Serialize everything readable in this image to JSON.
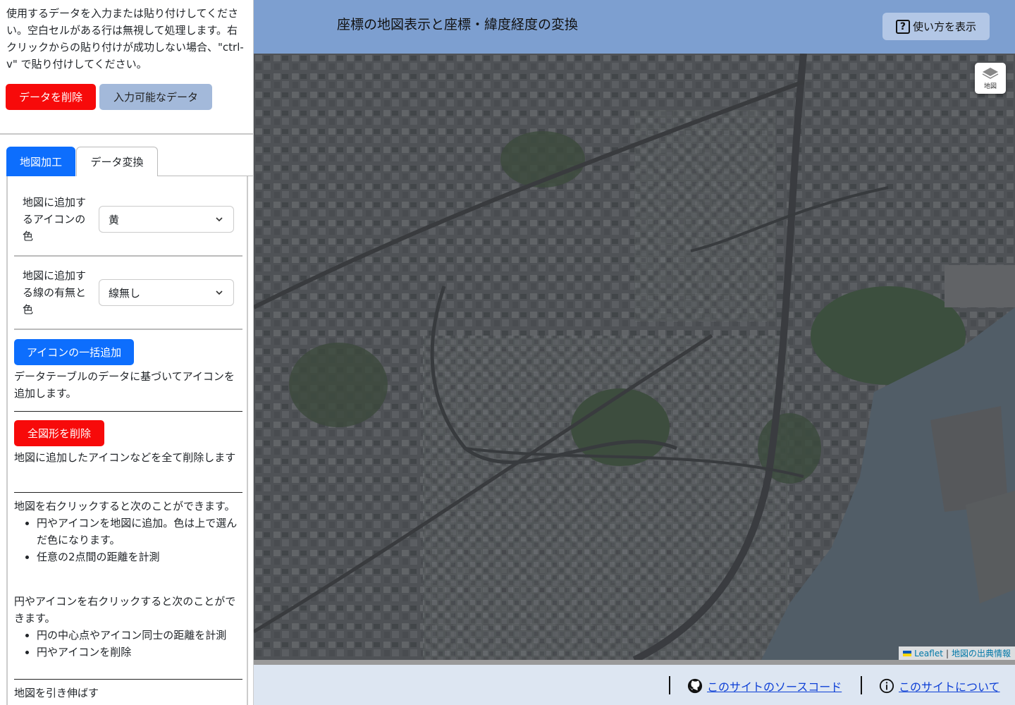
{
  "header": {
    "title": "座標の地図表示と座標・緯度経度の変換",
    "help_label": "使い方を表示"
  },
  "sidebar": {
    "intro": "使用するデータを入力または貼り付けしてください。空白セルがある行は無視して処理します。右クリックからの貼り付けが成功しない場合、\"ctrl-v\" で貼り付けしてください。",
    "delete_data_label": "データを削除",
    "available_data_label": "入力可能なデータ",
    "tabs": [
      {
        "label": "地図加工",
        "active": true
      },
      {
        "label": "データ変換",
        "active": false
      }
    ],
    "icon_color": {
      "label": "地図に追加するアイコンの色",
      "value": "黄"
    },
    "line_color": {
      "label": "地図に追加する線の有無と色",
      "value": "線無し"
    },
    "bulk_add_label": "アイコンの一括追加",
    "bulk_add_desc": "データテーブルのデータに基づいてアイコンを追加します。",
    "delete_all_label": "全図形を削除",
    "delete_all_desc": "地図に追加したアイコンなどを全て削除します",
    "map_right_click": {
      "intro": "地図を右クリックすると次のことができます。",
      "items": [
        "円やアイコンを地図に追加。色は上で選んだ色になります。",
        "任意の2点間の距離を計測"
      ]
    },
    "shape_right_click": {
      "intro": "円やアイコンを右クリックすると次のことができます。",
      "items": [
        "円の中心点やアイコン同士の距離を計測",
        "円やアイコンを削除"
      ]
    },
    "stretch_label": "地図を引き伸ばす"
  },
  "map": {
    "layer_label": "地図",
    "attribution_leaflet": "Leaflet",
    "attribution_sep": "|",
    "attribution_source": "地図の出典情報"
  },
  "footer": {
    "source_link": "このサイトのソースコード",
    "about_link": "このサイトについて"
  },
  "colors": {
    "accent_blue": "#0d6efd",
    "danger_red": "#f70a0a",
    "header_bg": "#7d9fd0",
    "link_blue": "#0d3fd6"
  }
}
